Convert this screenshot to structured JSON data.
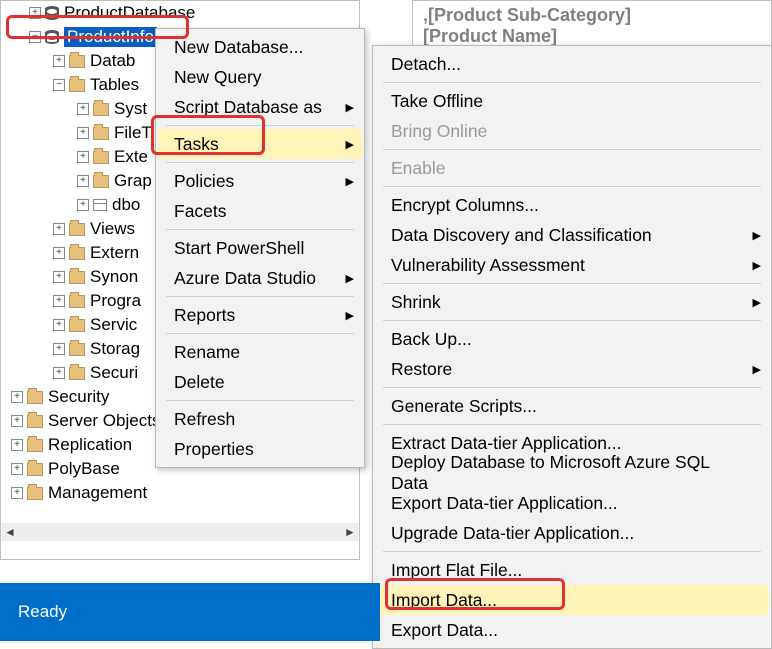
{
  "code": {
    "line1": ",[Product Sub-Category]",
    "line2": "[Product Name]"
  },
  "tree": {
    "top": "ProductDatabase",
    "selected": "ProductInfo",
    "n_datab": "Datab",
    "n_tables": "Tables",
    "n_sys": "Syst",
    "n_file": "FileT",
    "n_ext": "Exte",
    "n_graph": "Grap",
    "n_dbo": "dbo",
    "n_views": "Views",
    "n_extern": "Extern",
    "n_synon": "Synon",
    "n_progra": "Progra",
    "n_servic": "Servic",
    "n_storag": "Storag",
    "n_securi": "Securi",
    "r_security": "Security",
    "r_server": "Server Objects",
    "r_repl": "Replication",
    "r_poly": "PolyBase",
    "r_mgmt": "Management"
  },
  "menu1": {
    "newdb": "New Database...",
    "newq": "New Query",
    "scriptas": "Script Database as",
    "tasks": "Tasks",
    "policies": "Policies",
    "facets": "Facets",
    "powershell": "Start PowerShell",
    "ads": "Azure Data Studio",
    "reports": "Reports",
    "rename": "Rename",
    "delete": "Delete",
    "refresh": "Refresh",
    "props": "Properties"
  },
  "menu2": {
    "detach": "Detach...",
    "offline": "Take Offline",
    "online": "Bring Online",
    "enable": "Enable",
    "encrypt": "Encrypt Columns...",
    "ddc": "Data Discovery and Classification",
    "vuln": "Vulnerability Assessment",
    "shrink": "Shrink",
    "backup": "Back Up...",
    "restore": "Restore",
    "gen": "Generate Scripts...",
    "extract": "Extract Data-tier Application...",
    "deploy": "Deploy Database to Microsoft Azure SQL Data",
    "exportd": "Export Data-tier Application...",
    "upgrade": "Upgrade Data-tier Application...",
    "impflat": "Import Flat File...",
    "impdata": "Import Data...",
    "expdata": "Export Data..."
  },
  "status": "Ready"
}
